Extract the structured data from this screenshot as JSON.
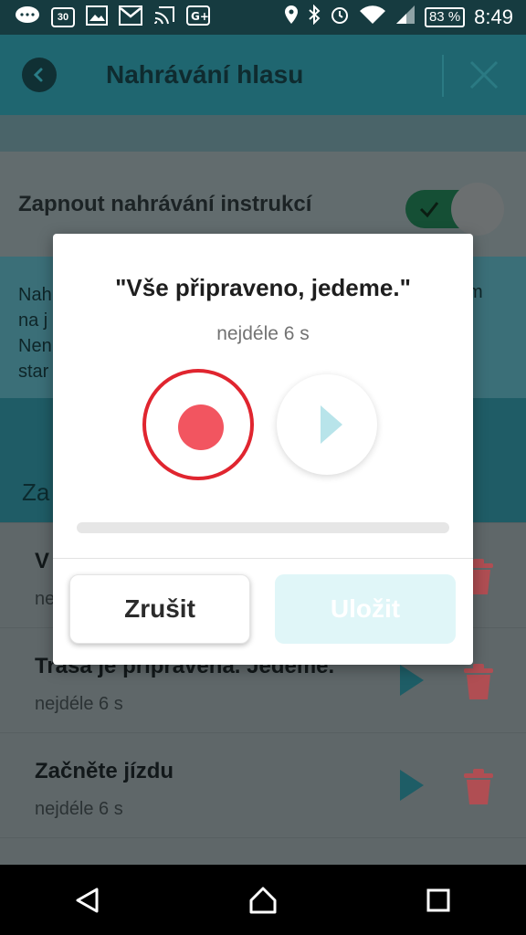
{
  "status_bar": {
    "calendar_day": "30",
    "battery": "83 %",
    "time": "8:49",
    "icons": [
      "messages-icon",
      "calendar-icon",
      "image-icon",
      "gmail-icon",
      "cast-icon",
      "google-plus-icon",
      "location-icon",
      "bluetooth-icon",
      "alarm-icon",
      "wifi-icon",
      "signal-icon",
      "battery-icon"
    ]
  },
  "app_bar": {
    "title": "Nahrávání hlasu",
    "back_icon": "back-icon",
    "close_icon": "close-icon"
  },
  "settings": {
    "toggle_label": "Zapnout nahrávání instrukcí",
    "toggle_on": true,
    "info_lines": [
      "Nah",
      "na j",
      "Nen",
      "star"
    ],
    "info_right": "m"
  },
  "section": {
    "title": "Za"
  },
  "list": {
    "items": [
      {
        "title": "V",
        "subtitle": "ne"
      },
      {
        "title": "Trasa je připravena. Jedeme.",
        "subtitle": "nejdéle 6 s"
      },
      {
        "title": "Začněte jízdu",
        "subtitle": "nejdéle 6 s"
      }
    ]
  },
  "dialog": {
    "title": "\"Vše připraveno, jedeme.\"",
    "subtitle": "nejdéle 6 s",
    "progress": 0,
    "cancel_label": "Zrušit",
    "save_label": "Uložit"
  },
  "colors": {
    "accent": "#38a7b5",
    "record": "#e0252f",
    "record_dot": "#f25560",
    "delete": "#c0555a"
  }
}
